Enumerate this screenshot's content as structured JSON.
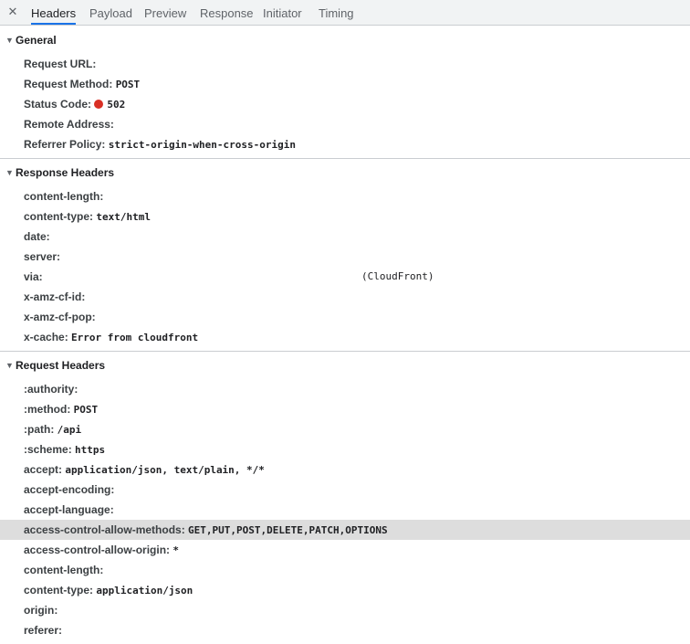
{
  "tabs": {
    "close_icon": "close-icon",
    "items": [
      "Headers",
      "Payload",
      "Preview",
      "Response",
      "Initiator",
      "Timing"
    ]
  },
  "colors": {
    "status_error": "#d93025",
    "active_tab_underline": "#1a73e8"
  },
  "general": {
    "title": "General",
    "rows": [
      {
        "key": "Request URL:",
        "value": ""
      },
      {
        "key": "Request Method:",
        "value": "POST"
      },
      {
        "key": "Status Code:",
        "value": "502"
      },
      {
        "key": "Remote Address:",
        "value": ""
      },
      {
        "key": "Referrer Policy:",
        "value": "strict-origin-when-cross-origin"
      }
    ]
  },
  "response_headers": {
    "title": "Response Headers",
    "rows": [
      {
        "key": "content-length:",
        "value": ""
      },
      {
        "key": "content-type:",
        "value": "text/html"
      },
      {
        "key": "date:",
        "value": ""
      },
      {
        "key": "server:",
        "value": ""
      },
      {
        "key": "via:",
        "value": "(CloudFront)"
      },
      {
        "key": "x-amz-cf-id:",
        "value": ""
      },
      {
        "key": "x-amz-cf-pop:",
        "value": ""
      },
      {
        "key": "x-cache:",
        "value": "Error from cloudfront"
      }
    ]
  },
  "request_headers": {
    "title": "Request Headers",
    "rows": [
      {
        "key": ":authority:",
        "value": ""
      },
      {
        "key": ":method:",
        "value": "POST"
      },
      {
        "key": ":path:",
        "value": "/api"
      },
      {
        "key": ":scheme:",
        "value": "https"
      },
      {
        "key": "accept:",
        "value": "application/json, text/plain, */*"
      },
      {
        "key": "accept-encoding:",
        "value": ""
      },
      {
        "key": "accept-language:",
        "value": ""
      },
      {
        "key": "access-control-allow-methods:",
        "value": "GET,PUT,POST,DELETE,PATCH,OPTIONS"
      },
      {
        "key": "access-control-allow-origin:",
        "value": "*"
      },
      {
        "key": "content-length:",
        "value": ""
      },
      {
        "key": "content-type:",
        "value": "application/json"
      },
      {
        "key": "origin:",
        "value": ""
      },
      {
        "key": "referer:",
        "value": ""
      }
    ]
  }
}
